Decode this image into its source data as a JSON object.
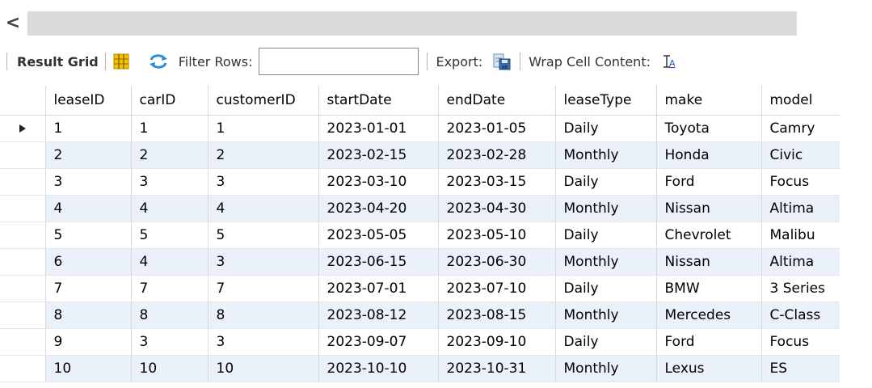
{
  "scroll": {
    "left_arrow": "<"
  },
  "toolbar": {
    "result_grid_label": "Result Grid",
    "filter_label": "Filter Rows:",
    "filter_value": "",
    "export_label": "Export:",
    "wrap_label": "Wrap Cell Content:",
    "icons": [
      "grid-layout-icon",
      "refresh-icon",
      "export-icon",
      "wrap-text-icon"
    ]
  },
  "grid": {
    "columns": [
      "leaseID",
      "carID",
      "customerID",
      "startDate",
      "endDate",
      "leaseType",
      "make",
      "model"
    ],
    "selected_row": 0,
    "rows": [
      [
        "1",
        "1",
        "1",
        "2023-01-01",
        "2023-01-05",
        "Daily",
        "Toyota",
        "Camry"
      ],
      [
        "2",
        "2",
        "2",
        "2023-02-15",
        "2023-02-28",
        "Monthly",
        "Honda",
        "Civic"
      ],
      [
        "3",
        "3",
        "3",
        "2023-03-10",
        "2023-03-15",
        "Daily",
        "Ford",
        "Focus"
      ],
      [
        "4",
        "4",
        "4",
        "2023-04-20",
        "2023-04-30",
        "Monthly",
        "Nissan",
        "Altima"
      ],
      [
        "5",
        "5",
        "5",
        "2023-05-05",
        "2023-05-10",
        "Daily",
        "Chevrolet",
        "Malibu"
      ],
      [
        "6",
        "4",
        "3",
        "2023-06-15",
        "2023-06-30",
        "Monthly",
        "Nissan",
        "Altima"
      ],
      [
        "7",
        "7",
        "7",
        "2023-07-01",
        "2023-07-10",
        "Daily",
        "BMW",
        "3 Series"
      ],
      [
        "8",
        "8",
        "8",
        "2023-08-12",
        "2023-08-15",
        "Monthly",
        "Mercedes",
        "C-Class"
      ],
      [
        "9",
        "3",
        "3",
        "2023-09-07",
        "2023-09-10",
        "Daily",
        "Ford",
        "Focus"
      ],
      [
        "10",
        "10",
        "10",
        "2023-10-10",
        "2023-10-31",
        "Monthly",
        "Lexus",
        "ES"
      ]
    ]
  }
}
